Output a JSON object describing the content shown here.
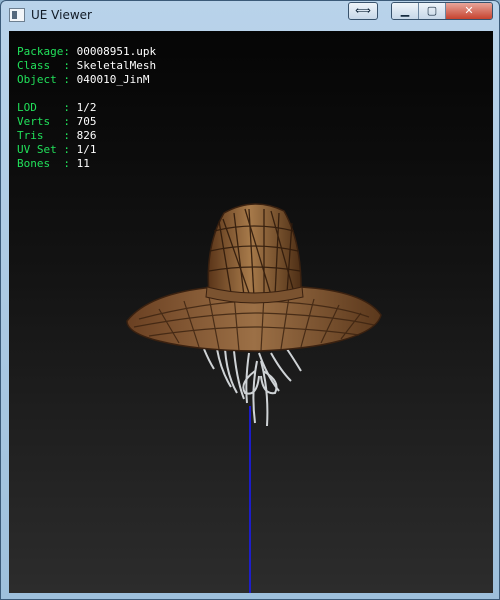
{
  "window": {
    "title": "UE Viewer",
    "restore_symbol": "⟺",
    "minimize_symbol": "▁",
    "maximize_symbol": "▢",
    "close_symbol": "✕"
  },
  "info": {
    "package": {
      "label": "Package:",
      "value": "00008951.upk"
    },
    "class": {
      "label": "Class  :",
      "value": "SkeletalMesh"
    },
    "object": {
      "label": "Object :",
      "value": "040010_JinM"
    },
    "lod": {
      "label": "LOD    :",
      "value": "1/2"
    },
    "verts": {
      "label": "Verts  :",
      "value": "705"
    },
    "tris": {
      "label": "Tris   :",
      "value": "826"
    },
    "uvset": {
      "label": "UV Set :",
      "value": "1/1"
    },
    "bones": {
      "label": "Bones  :",
      "value": "11"
    }
  },
  "colors": {
    "label": "#21e05a",
    "value": "#ffffff",
    "axis": "#1a1aff",
    "hat": "#8a5a33"
  }
}
